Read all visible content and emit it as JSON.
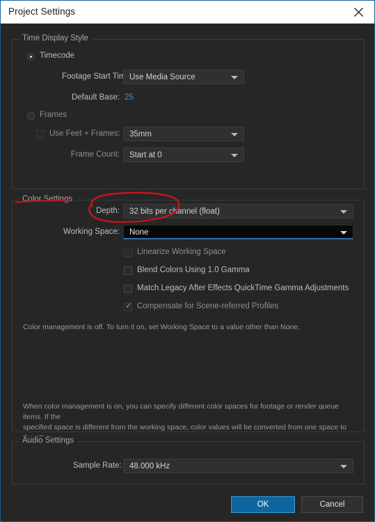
{
  "window": {
    "title": "Project Settings",
    "close_icon": "close-icon",
    "accent_color": "#0e66a0",
    "border_color": "#1f5f92",
    "background": "#262626",
    "annotation_color": "#c0171a"
  },
  "time_display_style": {
    "group_label": "Time Display Style",
    "timecode": {
      "label": "Timecode",
      "selected": true
    },
    "footage_start_time": {
      "label": "Footage Start Time:",
      "value": "Use Media Source"
    },
    "default_base": {
      "label": "Default Base:",
      "value": "25"
    },
    "frames": {
      "label": "Frames",
      "selected": false
    },
    "use_feet_frames": {
      "label": "Use Feet + Frames:",
      "checked": false,
      "value": "35mm"
    },
    "frame_count": {
      "label": "Frame Count:",
      "value": "Start at 0"
    }
  },
  "color_settings": {
    "group_label": "Color Settings",
    "depth": {
      "label": "Depth:",
      "value": "32 bits per channel (float)"
    },
    "working_space": {
      "label": "Working Space:",
      "value": "None"
    },
    "checkboxes": [
      {
        "label": "Linearize Working Space",
        "checked": false,
        "disabled": true
      },
      {
        "label": "Blend Colors Using 1.0 Gamma",
        "checked": false,
        "disabled": false
      },
      {
        "label": "Match Legacy After Effects QuickTime Gamma Adjustments",
        "checked": false,
        "disabled": false
      },
      {
        "label": "Compensate for Scene-referred Profiles",
        "checked": true,
        "disabled": true
      }
    ],
    "status_note": "Color management is off. To turn it on, set Working Space to a value other than None.",
    "footer_note": "When color management is on, you can specify different color spaces for footage or render queue items. If the\nspecified space is different from the working space, color values will be converted from one space to the other."
  },
  "audio_settings": {
    "group_label": "Audio Settings",
    "sample_rate": {
      "label": "Sample Rate:",
      "value": "48.000 kHz"
    }
  },
  "buttons": {
    "ok": "OK",
    "cancel": "Cancel"
  }
}
